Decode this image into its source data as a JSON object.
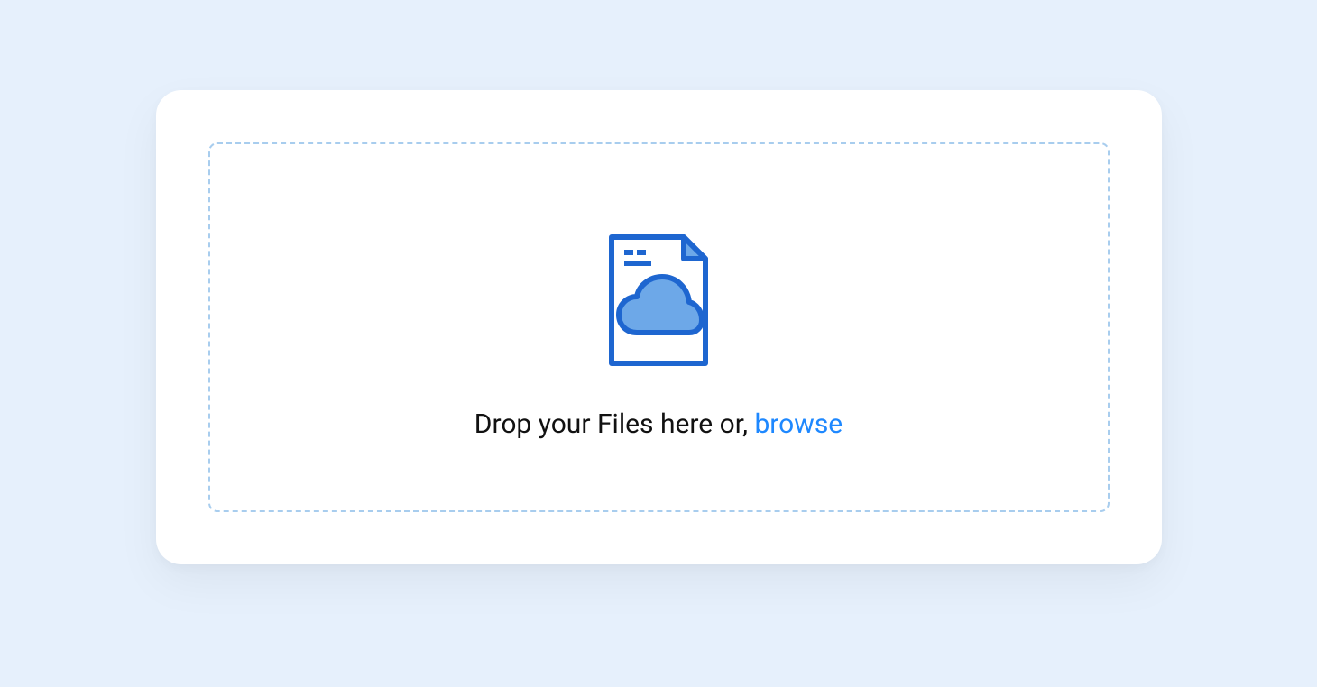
{
  "upload": {
    "prompt_text": "Drop your Files here or, ",
    "browse_label": "browse"
  }
}
